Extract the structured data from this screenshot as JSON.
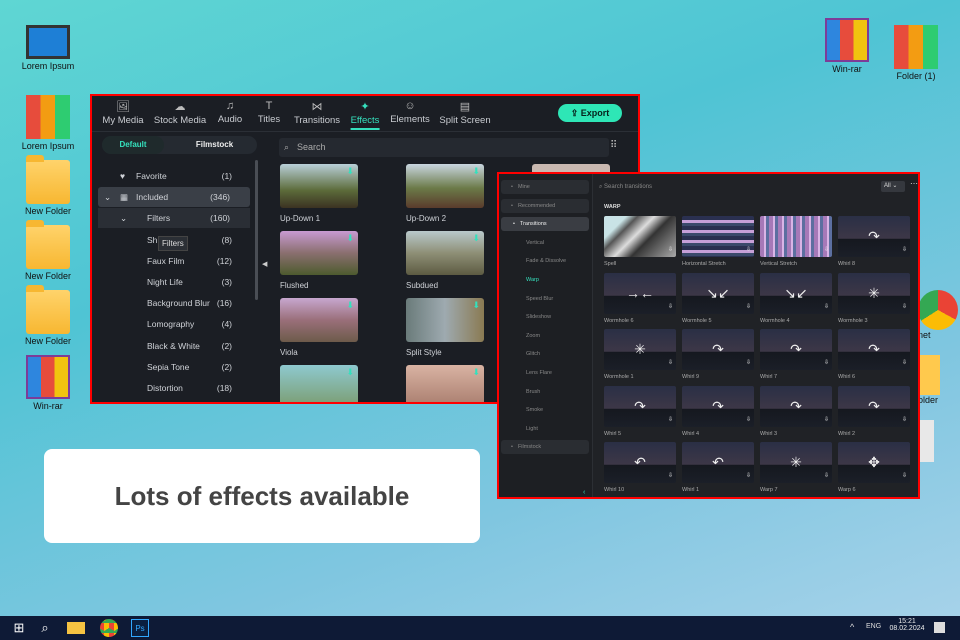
{
  "desktop": {
    "left": [
      {
        "label": "Lorem Ipsum",
        "icon": "computer-icon",
        "kind": "pc"
      },
      {
        "label": "Lorem Ipsum",
        "icon": "binders-icon",
        "kind": "binders"
      },
      {
        "label": "New Folder",
        "icon": "folder-icon",
        "kind": "folder"
      },
      {
        "label": "New Folder",
        "icon": "folder-icon",
        "kind": "folder"
      },
      {
        "label": "New Folder",
        "icon": "folder-icon",
        "kind": "folder"
      },
      {
        "label": "Win-rar",
        "icon": "winrar-icon",
        "kind": "winrar"
      }
    ],
    "right": [
      {
        "label": "Win-rar",
        "icon": "winrar-icon",
        "kind": "winrar"
      },
      {
        "label": "Folder (1)",
        "icon": "binders-icon",
        "kind": "binders"
      }
    ],
    "partial": [
      {
        "label": "net",
        "icon": "chrome-icon"
      },
      {
        "label": "older",
        "icon": "folder-icon"
      },
      {
        "label": "",
        "icon": "recycle-bin-icon"
      }
    ]
  },
  "effects_window": {
    "tabs": [
      {
        "label": "My Media",
        "icon": "🖼"
      },
      {
        "label": "Stock Media",
        "icon": "☁"
      },
      {
        "label": "Audio",
        "icon": "♫"
      },
      {
        "label": "Titles",
        "icon": "T"
      },
      {
        "label": "Transitions",
        "icon": "⋈"
      },
      {
        "label": "Effects",
        "icon": "✦"
      },
      {
        "label": "Elements",
        "icon": "☺"
      },
      {
        "label": "Split Screen",
        "icon": "▤"
      }
    ],
    "active_tab": "Effects",
    "export_label": "Export",
    "toggle": {
      "default": "Default",
      "filmstock": "Filmstock"
    },
    "tree": [
      {
        "label": "Favorite",
        "count": "(1)",
        "icon": "♥"
      },
      {
        "label": "Included",
        "count": "(346)",
        "icon": "▦",
        "expand": "⌄"
      },
      {
        "label": "Filters",
        "count": "(160)",
        "expand": "⌄"
      },
      {
        "label": "Sh",
        "count": "(8)"
      },
      {
        "label": "Faux Film",
        "count": "(12)"
      },
      {
        "label": "Night Life",
        "count": "(3)"
      },
      {
        "label": "Background Blur",
        "count": "(16)"
      },
      {
        "label": "Lomography",
        "count": "(4)"
      },
      {
        "label": "Black & White",
        "count": "(2)"
      },
      {
        "label": "Sepia Tone",
        "count": "(2)"
      },
      {
        "label": "Distortion",
        "count": "(18)"
      }
    ],
    "tooltip": "Filters",
    "search_placeholder": "Search",
    "effects": [
      "Up-Down 1",
      "Up-Down 2",
      "Flushed",
      "Subdued",
      "Viola",
      "Split Style",
      "",
      ""
    ]
  },
  "transitions_window": {
    "search_placeholder": "Search transitions",
    "filter": "All",
    "sidebar": [
      {
        "label": "Mine",
        "type": "box"
      },
      {
        "label": "Recommended",
        "type": "box"
      },
      {
        "label": "Transitions",
        "type": "sel"
      },
      {
        "label": "Vertical"
      },
      {
        "label": "Fade & Dissolve"
      },
      {
        "label": "Warp",
        "type": "act"
      },
      {
        "label": "Speed Blur"
      },
      {
        "label": "Slideshow"
      },
      {
        "label": "Zoom"
      },
      {
        "label": "Glitch"
      },
      {
        "label": "Lens Flare"
      },
      {
        "label": "Brush"
      },
      {
        "label": "Smoke"
      },
      {
        "label": "Light"
      },
      {
        "label": "Filmstock",
        "type": "box"
      }
    ],
    "section": "WARP",
    "items": [
      {
        "label": "Spell",
        "glyph": ""
      },
      {
        "label": "Horizontal Stretch",
        "glyph": ""
      },
      {
        "label": "Vertical Stretch",
        "glyph": ""
      },
      {
        "label": "Whirl 8",
        "glyph": "↷"
      },
      {
        "label": "Wormhole 6",
        "glyph": "→←"
      },
      {
        "label": "Wormhole 5",
        "glyph": "↘↙"
      },
      {
        "label": "Wormhole 4",
        "glyph": "↘↙"
      },
      {
        "label": "Wormhole 3",
        "glyph": "✳"
      },
      {
        "label": "Wormhole 1",
        "glyph": "✳"
      },
      {
        "label": "Whirl 9",
        "glyph": "↷"
      },
      {
        "label": "Whirl 7",
        "glyph": "↷"
      },
      {
        "label": "Whirl 6",
        "glyph": "↷"
      },
      {
        "label": "Whirl 5",
        "glyph": "↷"
      },
      {
        "label": "Whirl 4",
        "glyph": "↷"
      },
      {
        "label": "Whirl 3",
        "glyph": "↷"
      },
      {
        "label": "Whirl 2",
        "glyph": "↷"
      },
      {
        "label": "Whirl 10",
        "glyph": "↶"
      },
      {
        "label": "Whirl 1",
        "glyph": "↶"
      },
      {
        "label": "Warp 7",
        "glyph": "✳"
      },
      {
        "label": "Warp 6",
        "glyph": "✥"
      }
    ]
  },
  "caption": "Lots of effects available",
  "taskbar": {
    "lang": "ENG",
    "time": "15:21",
    "date": "08.02.2024"
  }
}
